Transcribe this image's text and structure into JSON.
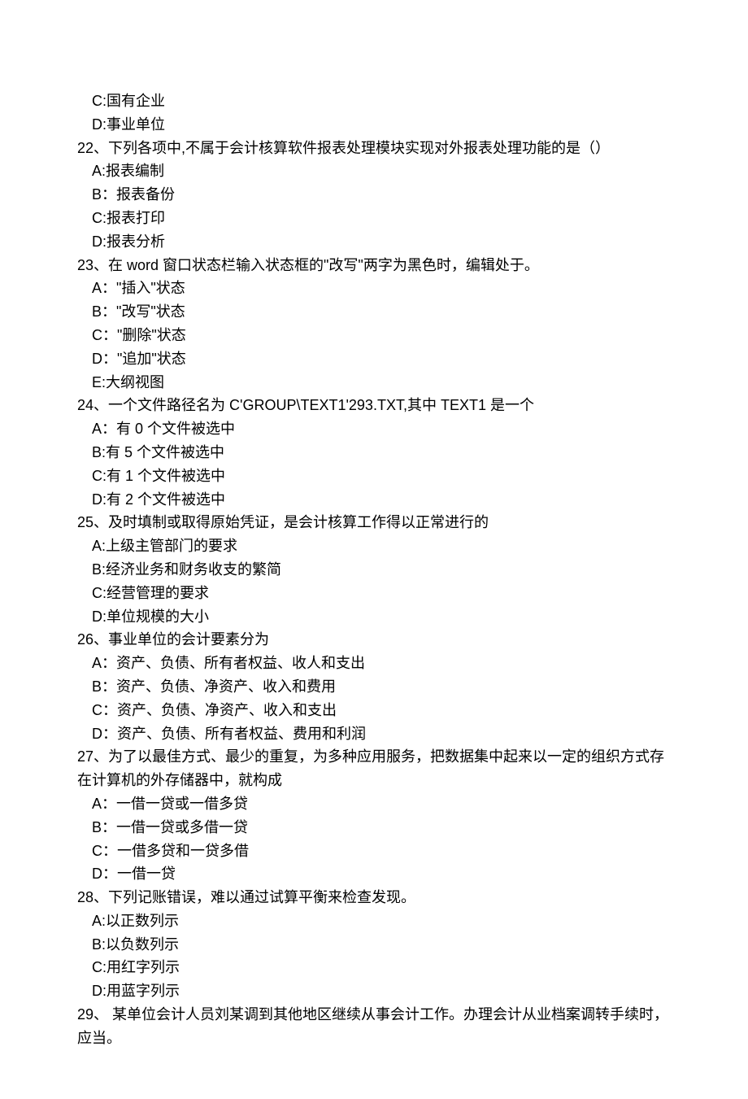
{
  "lines": {
    "q21_optC": "C:国有企业",
    "q21_optD": "D:事业单位",
    "q22_stem": "22、下列各项中,不属于会计核算软件报表处理模块实现对外报表处理功能的是（）",
    "q22_optA": "A:报表编制",
    "q22_optB": "B：报表备份",
    "q22_optC": "C:报表打印",
    "q22_optD": "D:报表分析",
    "q23_stem": "23、在 word 窗口状态栏输入状态框的\"改写\"两字为黑色时，编辑处于。",
    "q23_optA": "A：\"插入\"状态",
    "q23_optB": "B：\"改写\"状态",
    "q23_optC": "C：\"删除\"状态",
    "q23_optD": "D：\"追加\"状态",
    "q23_optE": "E:大纲视图",
    "q24_stem": "24、一个文件路径名为 C'GROUP\\TEXT1'293.TXT,其中 TEXT1 是一个",
    "q24_optA": "A：有 0 个文件被选中",
    "q24_optB": "B:有 5 个文件被选中",
    "q24_optC": "C:有 1 个文件被选中",
    "q24_optD": "D:有 2 个文件被选中",
    "q25_stem": "25、及时填制或取得原始凭证，是会计核算工作得以正常进行的",
    "q25_optA": "A:上级主管部门的要求",
    "q25_optB": "B:经济业务和财务收支的繁简",
    "q25_optC": "C:经营管理的要求",
    "q25_optD": "D:单位规模的大小",
    "q26_stem": "26、事业单位的会计要素分为",
    "q26_optA": "A：资产、负债、所有者权益、收人和支出",
    "q26_optB": "B：资产、负债、净资产、收入和费用",
    "q26_optC": "C：资产、负债、净资产、收入和支出",
    "q26_optD": "D：资产、负债、所有者权益、费用和利润",
    "q27_stem": "27、为了以最佳方式、最少的重复，为多种应用服务，把数据集中起来以一定的组织方式存在计算机的外存储器中，就构成",
    "q27_optA": "A：一借一贷或一借多贷",
    "q27_optB": "B：一借一贷或多借一贷",
    "q27_optC": "C：一借多贷和一贷多借",
    "q27_optD": "D：一借一贷",
    "q28_stem": "28、下列记账错误，难以通过试算平衡来检查发现。",
    "q28_optA": "A:以正数列示",
    "q28_optB": "B:以负数列示",
    "q28_optC": "C:用红字列示",
    "q28_optD": "D:用蓝字列示",
    "q29_stem": "29、 某单位会计人员刘某调到其他地区继续从事会计工作。办理会计从业档案调转手续时，应当。"
  }
}
